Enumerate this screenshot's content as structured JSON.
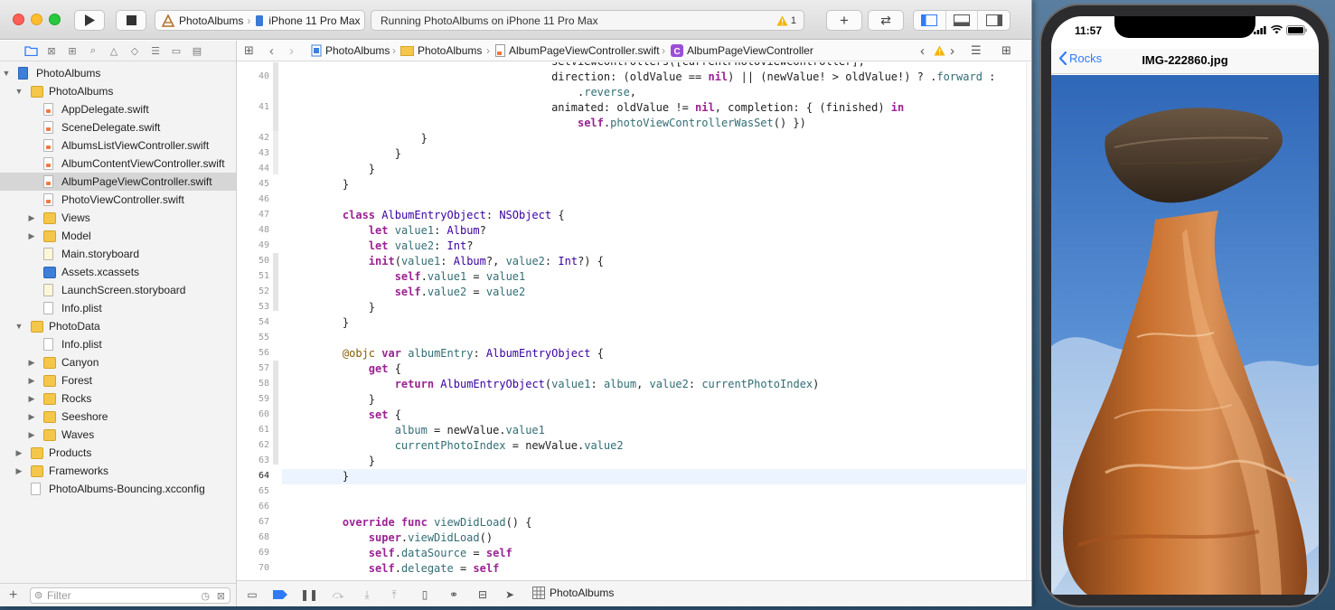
{
  "xcode": {
    "scheme": {
      "project": "PhotoAlbums",
      "device": "iPhone 11 Pro Max"
    },
    "activity": {
      "status": "Running PhotoAlbums on iPhone 11 Pro Max",
      "warning_count": "1"
    }
  },
  "navigator": {
    "items": [
      {
        "label": "PhotoAlbums",
        "level": 0,
        "kind": "project",
        "disclosure": "open"
      },
      {
        "label": "PhotoAlbums",
        "level": 1,
        "kind": "folder",
        "disclosure": "open"
      },
      {
        "label": "AppDelegate.swift",
        "level": 2,
        "kind": "swift"
      },
      {
        "label": "SceneDelegate.swift",
        "level": 2,
        "kind": "swift"
      },
      {
        "label": "AlbumsListViewController.swift",
        "level": 2,
        "kind": "swift"
      },
      {
        "label": "AlbumContentViewController.swift",
        "level": 2,
        "kind": "swift"
      },
      {
        "label": "AlbumPageViewController.swift",
        "level": 2,
        "kind": "swift",
        "selected": true
      },
      {
        "label": "PhotoViewController.swift",
        "level": 2,
        "kind": "swift"
      },
      {
        "label": "Views",
        "level": 2,
        "kind": "folder",
        "disclosure": "closed"
      },
      {
        "label": "Model",
        "level": 2,
        "kind": "folder",
        "disclosure": "closed"
      },
      {
        "label": "Main.storyboard",
        "level": 2,
        "kind": "storyboard"
      },
      {
        "label": "Assets.xcassets",
        "level": 2,
        "kind": "assets"
      },
      {
        "label": "LaunchScreen.storyboard",
        "level": 2,
        "kind": "storyboard"
      },
      {
        "label": "Info.plist",
        "level": 2,
        "kind": "file"
      },
      {
        "label": "PhotoData",
        "level": 1,
        "kind": "folder",
        "disclosure": "open"
      },
      {
        "label": "Info.plist",
        "level": 2,
        "kind": "file"
      },
      {
        "label": "Canyon",
        "level": 2,
        "kind": "folder",
        "disclosure": "closed"
      },
      {
        "label": "Forest",
        "level": 2,
        "kind": "folder",
        "disclosure": "closed"
      },
      {
        "label": "Rocks",
        "level": 2,
        "kind": "folder",
        "disclosure": "closed"
      },
      {
        "label": "Seeshore",
        "level": 2,
        "kind": "folder",
        "disclosure": "closed"
      },
      {
        "label": "Waves",
        "level": 2,
        "kind": "folder",
        "disclosure": "closed"
      },
      {
        "label": "Products",
        "level": 1,
        "kind": "folder",
        "disclosure": "closed"
      },
      {
        "label": "Frameworks",
        "level": 1,
        "kind": "folder",
        "disclosure": "closed"
      },
      {
        "label": "PhotoAlbums-Bouncing.xcconfig",
        "level": 1,
        "kind": "file"
      }
    ],
    "filter_placeholder": "Filter"
  },
  "jumpbar": {
    "crumbs": [
      "PhotoAlbums",
      "PhotoAlbums",
      "AlbumPageViewController.swift",
      "AlbumPageViewController"
    ]
  },
  "editor": {
    "current_line": "64",
    "lines": [
      {
        "n": "",
        "text": "                                    setViewControllers([currentPhotoViewController],",
        "cut": true
      },
      {
        "n": "40",
        "text": "                                    direction: (oldValue == nil) || (newValue! > oldValue!) ? .forward :"
      },
      {
        "n": "",
        "text": "                                        .reverse,"
      },
      {
        "n": "41",
        "text": "                                    animated: oldValue != nil, completion: { (finished) in"
      },
      {
        "n": "",
        "text": "                                        self.photoViewControllerWasSet() })"
      },
      {
        "n": "42",
        "text": "                }"
      },
      {
        "n": "43",
        "text": "            }"
      },
      {
        "n": "44",
        "text": "        }"
      },
      {
        "n": "45",
        "text": "    }"
      },
      {
        "n": "46",
        "text": ""
      },
      {
        "n": "47",
        "text": "    class AlbumEntryObject: NSObject {"
      },
      {
        "n": "48",
        "text": "        let value1: Album?"
      },
      {
        "n": "49",
        "text": "        let value2: Int?"
      },
      {
        "n": "50",
        "text": "        init(value1: Album?, value2: Int?) {"
      },
      {
        "n": "51",
        "text": "            self.value1 = value1"
      },
      {
        "n": "52",
        "text": "            self.value2 = value2"
      },
      {
        "n": "53",
        "text": "        }"
      },
      {
        "n": "54",
        "text": "    }"
      },
      {
        "n": "55",
        "text": ""
      },
      {
        "n": "56",
        "text": "    @objc var albumEntry: AlbumEntryObject {"
      },
      {
        "n": "57",
        "text": "        get {"
      },
      {
        "n": "58",
        "text": "            return AlbumEntryObject(value1: album, value2: currentPhotoIndex)"
      },
      {
        "n": "59",
        "text": "        }"
      },
      {
        "n": "60",
        "text": "        set {"
      },
      {
        "n": "61",
        "text": "            album = newValue.value1"
      },
      {
        "n": "62",
        "text": "            currentPhotoIndex = newValue.value2"
      },
      {
        "n": "63",
        "text": "        }"
      },
      {
        "n": "64",
        "text": "    }"
      },
      {
        "n": "65",
        "text": ""
      },
      {
        "n": "66",
        "text": ""
      },
      {
        "n": "67",
        "text": "    override func viewDidLoad() {"
      },
      {
        "n": "68",
        "text": "        super.viewDidLoad()"
      },
      {
        "n": "69",
        "text": "        self.dataSource = self"
      },
      {
        "n": "70",
        "text": "        self.delegate = self"
      }
    ]
  },
  "debugbar": {
    "target": "PhotoAlbums"
  },
  "simulator": {
    "time": "11:57",
    "back_label": "Rocks",
    "title": "IMG-222860.jpg"
  },
  "colors": {
    "keyword": "#9b2393",
    "type": "#3900a0",
    "property": "#326d74",
    "ios_blue": "#2f7bf6",
    "selection": "#d6d6d6"
  }
}
